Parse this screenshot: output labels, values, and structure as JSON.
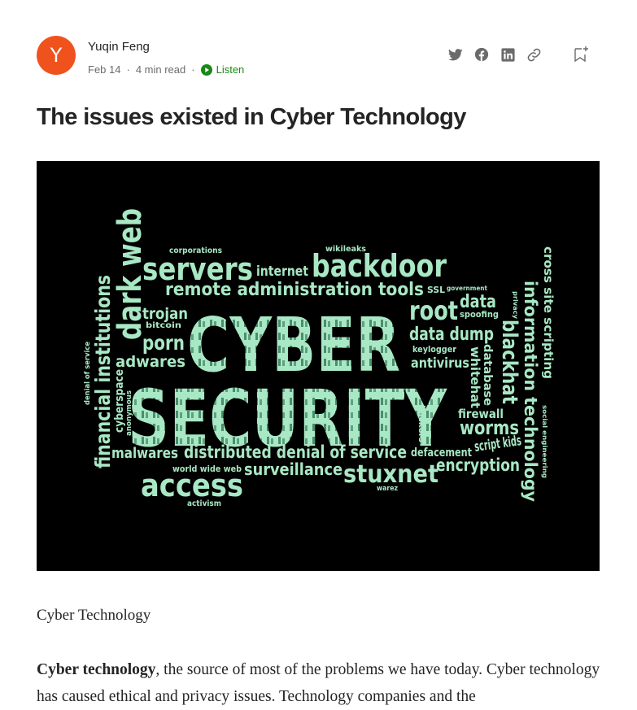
{
  "author": {
    "initial": "Y",
    "name": "Yuqin Feng",
    "date": "Feb 14",
    "read_time": "4 min read",
    "listen_label": "Listen",
    "avatar_color": "#f0521e"
  },
  "share_icons": [
    "twitter-icon",
    "facebook-icon",
    "linkedin-icon",
    "link-icon"
  ],
  "article": {
    "title": "The issues existed in Cyber Technology",
    "image_caption": "Cyber Technology",
    "para_bold": "Cyber technology",
    "para_rest": ", the source of most of the problems we have today. Cyber technology has caused ethical and privacy issues. Technology companies and the"
  },
  "wordcloud": {
    "color": "#a8e8c4",
    "words": [
      "CYBER",
      "SECURITY",
      "dark web",
      "servers",
      "internet",
      "backdoor",
      "wikileaks",
      "corporations",
      "remote administration tools",
      "SSL",
      "government",
      "root",
      "spoofing",
      "data",
      "data dump",
      "keylogger",
      "antivirus",
      "trojan",
      "bitcoin",
      "porn",
      "adwares",
      "financial institutions",
      "cyberspace",
      "anonymous",
      "denial of service",
      "blackhat",
      "whitehat",
      "database",
      "information technology",
      "cross site scripting",
      "privacy",
      "social engineering",
      "firewall",
      "worms",
      "hackers",
      "script kids",
      "malwares",
      "distributed denial of service",
      "defacement",
      "encryption",
      "world wide web",
      "surveillance",
      "stuxnet",
      "access",
      "warez",
      "activism"
    ]
  }
}
